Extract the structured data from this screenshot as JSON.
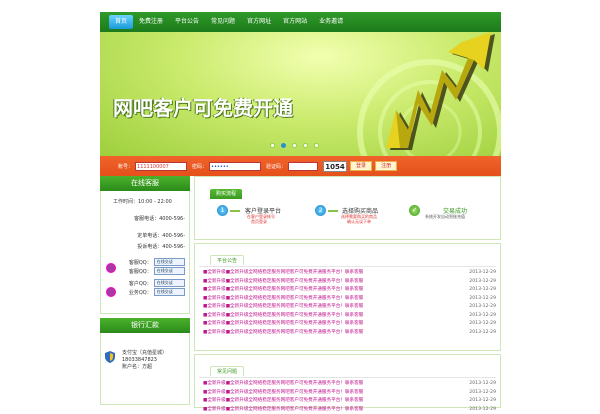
{
  "nav": {
    "items": [
      "首页",
      "免费注册",
      "平台公告",
      "常见问题",
      "官方网址",
      "官方网站",
      "业务邀请"
    ]
  },
  "banner": {
    "title": "网吧客户可免费开通"
  },
  "login": {
    "account_label": "账号：",
    "account_value": "1111100007",
    "password_label": "密码：",
    "password_value": "••••••",
    "captcha_label": "验证码：",
    "captcha_image": "1054",
    "login_button": "登录",
    "register_button": "注册"
  },
  "sidebar": {
    "online_title": "在线客服",
    "service_time": "工作时间：10:00 - 22:00",
    "phones": [
      "客服电话：4000-596-",
      "定单电话：400-596-",
      "投诉电话：400-596-"
    ],
    "qq": [
      {
        "label": "客服QQ：",
        "button": "在线交谈"
      },
      {
        "label": "客服QQ：",
        "button": "在线交谈"
      },
      {
        "label": "客户QQ：",
        "button": "在线交谈"
      },
      {
        "label": "业务QQ：",
        "button": "在线交谈"
      }
    ],
    "bank_title": "银行汇款",
    "bank_lines": [
      "支付宝（充值星城）",
      "18033847823",
      "账户名：方超"
    ]
  },
  "steps": {
    "tab": "购买流程",
    "step1_title": "客户登录平台",
    "step1_sub": [
      "在客户登录帐号",
      "首页登录"
    ],
    "step2_title": "选择购买商品",
    "step2_sub": [
      "选择需要购买的商品",
      "确认无误下单"
    ],
    "step3_title": "交易成功",
    "step3_sub": "系统开发自动到账充值"
  },
  "announcements": {
    "tab": "平台公告",
    "items": [
      {
        "text": "■全新升级■全新升级全网络稳定服务网吧客户可免费开通服务平台！联系客服",
        "date": "2013-12-29"
      },
      {
        "text": "■全新升级■全新升级全网络稳定服务网吧客户可免费开通服务平台！联系客服",
        "date": "2013-12-29"
      },
      {
        "text": "■全新升级■全新升级全网络稳定服务网吧客户可免费开通服务平台！联系客服",
        "date": "2013-12-29"
      },
      {
        "text": "■全新升级■全新升级全网络稳定服务网吧客户可免费开通服务平台！联系客服",
        "date": "2013-12-29"
      },
      {
        "text": "■全新升级■全新升级全网络稳定服务网吧客户可免费开通服务平台！联系客服",
        "date": "2013-12-29"
      },
      {
        "text": "■全新升级■全新升级全网络稳定服务网吧客户可免费开通服务平台！联系客服",
        "date": "2013-12-29"
      },
      {
        "text": "■全新升级■全新升级全网络稳定服务网吧客户可免费开通服务平台！联系客服",
        "date": "2013-12-29"
      },
      {
        "text": "■全新升级■全新升级全网络稳定服务网吧客户可免费开通服务平台！联系客服",
        "date": "2013-12-29"
      }
    ]
  },
  "faq": {
    "tab": "常见问题",
    "items": [
      {
        "text": "■全新升级■全新升级全网络稳定服务网吧客户可免费开通服务平台！联系客服",
        "date": "2013-12-29"
      },
      {
        "text": "■全新升级■全新升级全网络稳定服务网吧客户可免费开通服务平台！联系客服",
        "date": "2013-12-29"
      },
      {
        "text": "■全新升级■全新升级全网络稳定服务网吧客户可免费开通服务平台！联系客服",
        "date": "2013-12-29"
      },
      {
        "text": "■全新升级■全新升级全网络稳定服务网吧客户可免费开通服务平台！联系客服",
        "date": "2013-12-29"
      }
    ]
  },
  "colors": {
    "nav_green": "#2f9a2a",
    "login_orange": "#e5501b",
    "link_magenta": "#c2168f"
  }
}
